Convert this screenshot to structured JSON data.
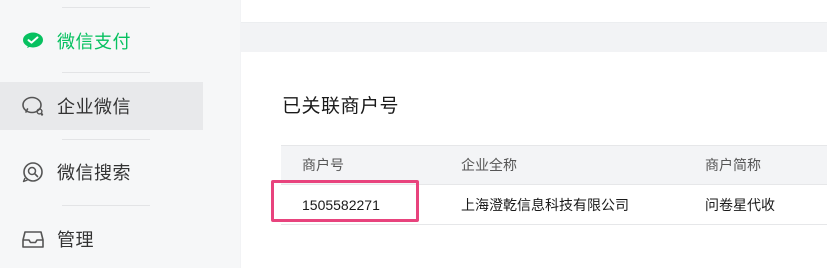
{
  "sidebar": {
    "items": [
      {
        "label": "微信支付",
        "icon": "wechat-pay-icon",
        "color": "#07c160"
      },
      {
        "label": "企业微信",
        "icon": "work-wechat-icon",
        "color": "#333333"
      },
      {
        "label": "微信搜索",
        "icon": "wechat-search-icon",
        "color": "#333333"
      },
      {
        "label": "管理",
        "icon": "inbox-icon",
        "color": "#333333"
      }
    ]
  },
  "main": {
    "section_title": "已关联商户号",
    "table": {
      "headers": [
        "商户号",
        "企业全称",
        "商户简称"
      ],
      "rows": [
        [
          "1505582271",
          "上海澄乾信息科技有限公司",
          "问卷星代收"
        ]
      ]
    }
  },
  "colors": {
    "accent_green": "#07c160",
    "highlight": "#e8437d"
  }
}
